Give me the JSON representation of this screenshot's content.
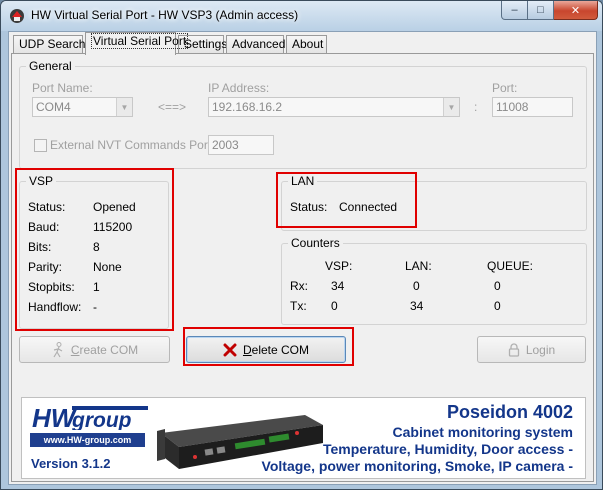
{
  "window": {
    "title": "HW Virtual Serial Port - HW VSP3 (Admin access)",
    "min_glyph": "–",
    "max_glyph": "□",
    "close_glyph": "✕"
  },
  "tabs": [
    {
      "label": "UDP Search",
      "active": false
    },
    {
      "label": "Virtual Serial Port",
      "active": true
    },
    {
      "label": "Settings",
      "active": false
    },
    {
      "label": "Advanced",
      "active": false
    },
    {
      "label": "About",
      "active": false
    }
  ],
  "general": {
    "group_label": "General",
    "port_name_label": "Port Name:",
    "port_name_value": "COM4",
    "arrow": "<==>",
    "ip_label": "IP Address:",
    "ip_value": "192.168.16.2",
    "colon": ":",
    "port_label": "Port:",
    "port_value": "11008",
    "nvt_label": "External NVT Commands Port:",
    "nvt_checked": false,
    "nvt_value": "2003"
  },
  "vsp": {
    "group_label": "VSP",
    "rows": [
      {
        "label": "Status:",
        "value": "Opened"
      },
      {
        "label": "Baud:",
        "value": "115200"
      },
      {
        "label": "Bits:",
        "value": "8"
      },
      {
        "label": "Parity:",
        "value": "None"
      },
      {
        "label": "Stopbits:",
        "value": "1"
      },
      {
        "label": "Handflow:",
        "value": "-"
      }
    ]
  },
  "lan": {
    "group_label": "LAN",
    "status_label": "Status:",
    "status_value": "Connected"
  },
  "counters": {
    "group_label": "Counters",
    "columns": [
      "VSP:",
      "LAN:",
      "QUEUE:"
    ],
    "rows": [
      {
        "label": "Rx:",
        "values": [
          "34",
          "0",
          "0"
        ]
      },
      {
        "label": "Tx:",
        "values": [
          "0",
          "34",
          "0"
        ]
      }
    ]
  },
  "buttons": {
    "create_com_prefix": "C",
    "create_com_rest": "reate COM",
    "create_com_enabled": false,
    "delete_com_prefix": "D",
    "delete_com_rest": "elete COM",
    "delete_com_enabled": true,
    "login_label": "Login",
    "login_enabled": false
  },
  "banner": {
    "logo_hw": "HW",
    "logo_group": "group",
    "url": "www.HW-group.com",
    "version": "Version  3.1.2",
    "product_title": "Poseidon 4002",
    "lines": [
      "Cabinet monitoring system",
      "Temperature, Humidity, Door access -",
      "Voltage, power monitoring, Smoke, IP camera -"
    ]
  },
  "colors": {
    "highlight_box": "#e00000",
    "brand_blue": "#13368a",
    "delete_icon": "#c00000"
  },
  "icons": {
    "create_com": "walking-person-icon",
    "delete_com": "red-x-icon",
    "login": "padlock-icon",
    "app": "hw-app-icon"
  }
}
